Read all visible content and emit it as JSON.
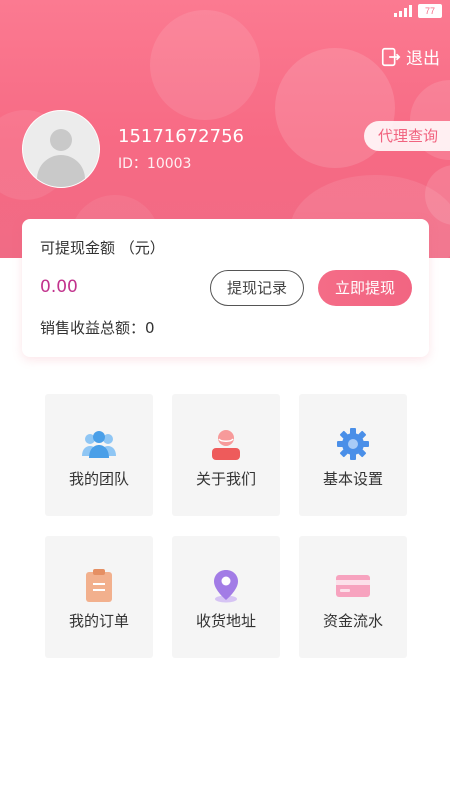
{
  "status_bar": {
    "battery": "77"
  },
  "header": {
    "logout_label": "退出",
    "phone": "15171672756",
    "user_id": "ID：10003",
    "agent_query_label": "代理查询"
  },
  "balance_card": {
    "title": "可提现金额 （元）",
    "amount": "0.00",
    "record_button": "提现记录",
    "withdraw_button": "立即提现",
    "sales_total": "销售收益总额：0"
  },
  "menu": {
    "items": [
      {
        "label": "我的团队",
        "icon": "team-icon"
      },
      {
        "label": "关于我们",
        "icon": "person-icon"
      },
      {
        "label": "基本设置",
        "icon": "gear-icon"
      },
      {
        "label": "我的订单",
        "icon": "clipboard-icon"
      },
      {
        "label": "收货地址",
        "icon": "location-pin-icon"
      },
      {
        "label": "资金流水",
        "icon": "credit-card-icon"
      }
    ]
  },
  "colors": {
    "brand_pink": "#f46c87",
    "amount_text": "#c2338d"
  }
}
